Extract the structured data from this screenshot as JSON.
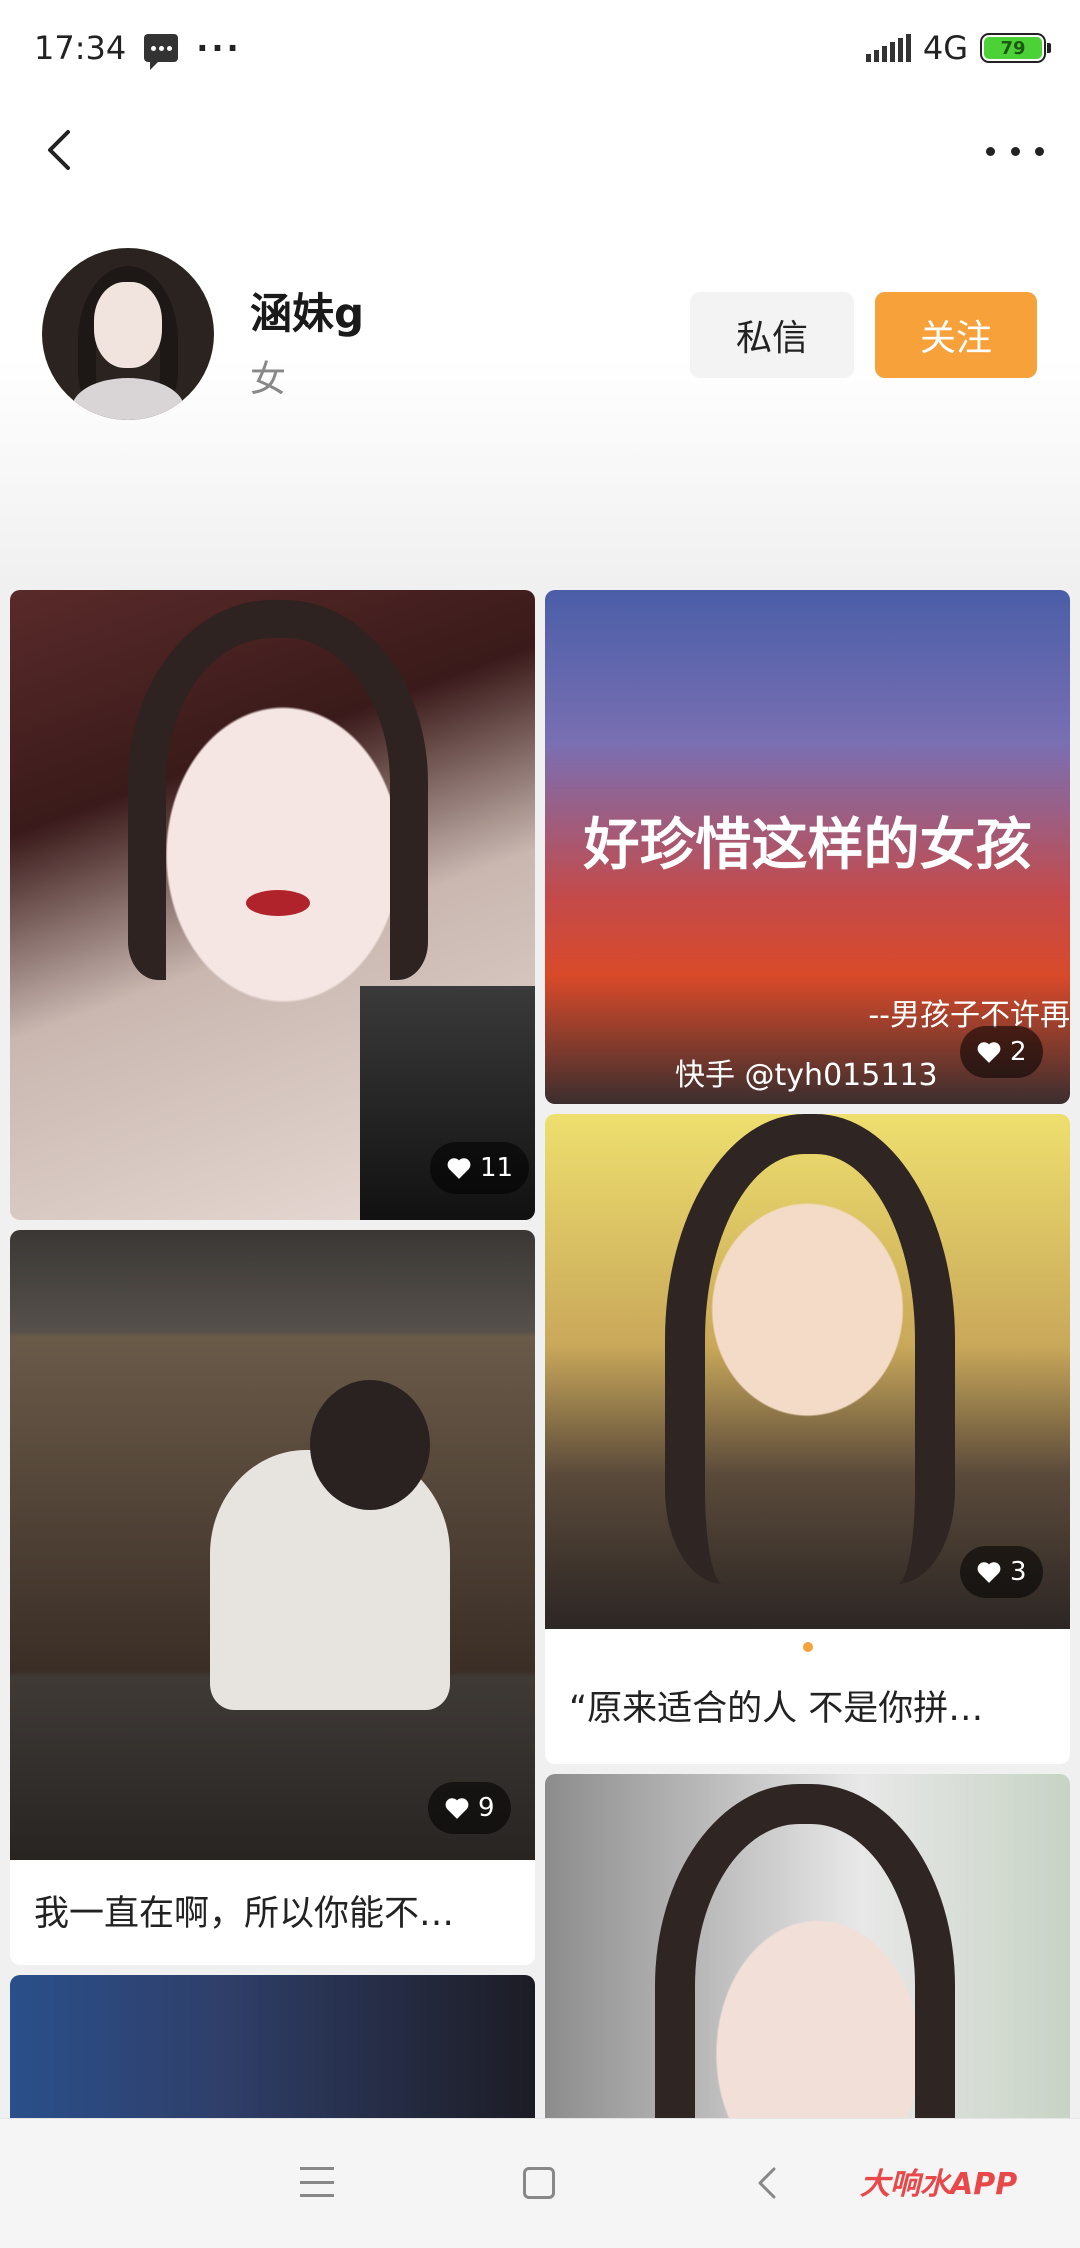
{
  "status_bar": {
    "time": "17:34",
    "more": "···",
    "network": "4G",
    "battery": "79"
  },
  "nav": {
    "back_icon": "chevron-left-icon",
    "more_icon": "more-icon"
  },
  "profile": {
    "name": "涵妹g",
    "gender": "女",
    "message_button": "私信",
    "follow_button": "关注",
    "accent_color": "#f7a13b"
  },
  "posts": [
    {
      "likes": "11"
    },
    {
      "overlay_text": "好珍惜这样的女孩",
      "sub_text": "--男孩子不许再",
      "watermark": "快手 @tyh015113",
      "likes": "2"
    },
    {
      "likes": "9",
      "caption": "我一直在啊，所以你能不…"
    },
    {
      "likes": "3",
      "caption": "“原来适合的人 不是你拼…"
    },
    {},
    {}
  ],
  "bottom_bar": {
    "brand": "大响水APP"
  }
}
